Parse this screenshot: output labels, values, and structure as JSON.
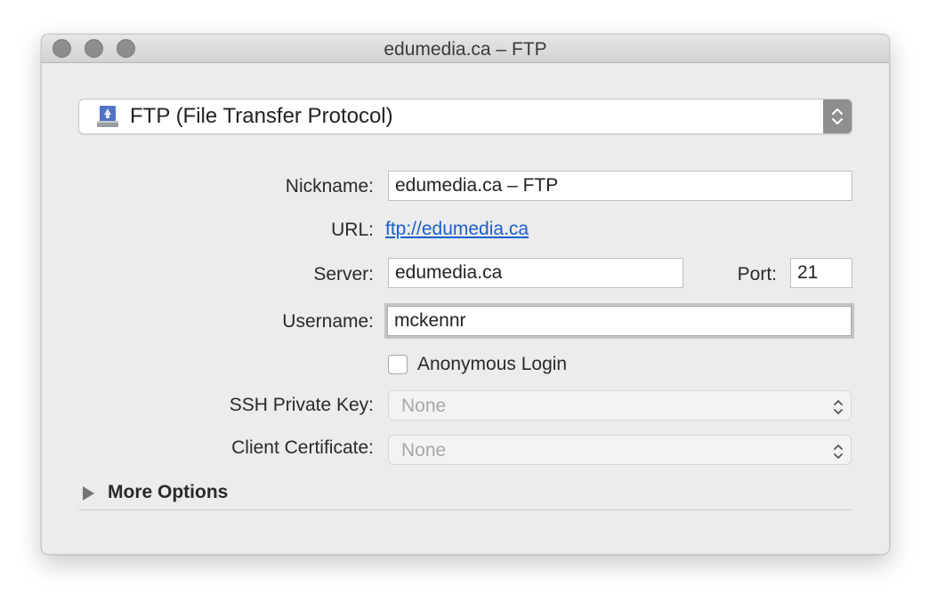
{
  "window": {
    "title": "edumedia.ca – FTP"
  },
  "protocol": {
    "label": "FTP (File Transfer Protocol)",
    "icon": "ftp-drive-icon"
  },
  "form": {
    "nickname_label": "Nickname:",
    "nickname_value": "edumedia.ca – FTP",
    "url_label": "URL:",
    "url_value": "ftp://edumedia.ca",
    "server_label": "Server:",
    "server_value": "edumedia.ca",
    "port_label": "Port:",
    "port_value": "21",
    "username_label": "Username:",
    "username_value": "mckennr",
    "anonymous_label": "Anonymous Login",
    "anonymous_checked": false,
    "ssh_key_label": "SSH Private Key:",
    "ssh_key_value": "None",
    "client_cert_label": "Client Certificate:",
    "client_cert_value": "None"
  },
  "more_options": {
    "label": "More Options"
  },
  "colors": {
    "link": "#1a5fcf",
    "window_bg": "#ececec"
  }
}
